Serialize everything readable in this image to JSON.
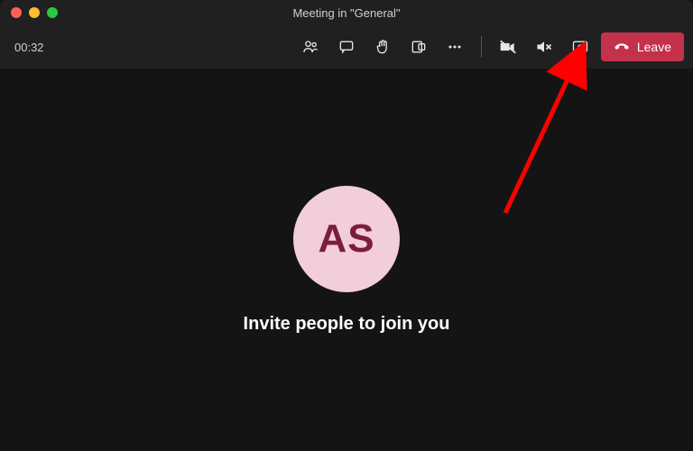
{
  "titlebar": {
    "title": "Meeting in \"General\""
  },
  "toolbar": {
    "timer": "00:32",
    "leave_label": "Leave"
  },
  "stage": {
    "avatar_initials": "AS",
    "prompt": "Invite people to join you"
  },
  "colors": {
    "leave_bg": "#c4314b",
    "avatar_bg": "#f2cdda",
    "avatar_fg": "#7b1d3f",
    "arrow": "#ff0000"
  }
}
